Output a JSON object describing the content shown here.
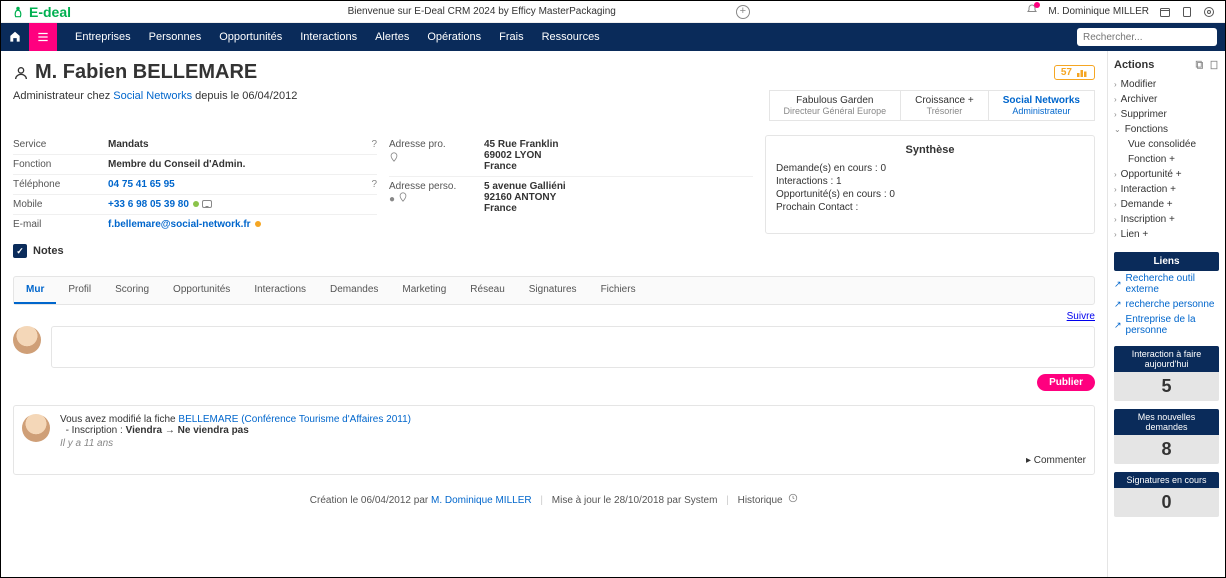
{
  "top": {
    "logo_text": "E-deal",
    "welcome": "Bienvenue sur E-Deal CRM 2024 by Efficy MasterPackaging",
    "user": "M. Dominique MILLER"
  },
  "nav": {
    "items": [
      "Entreprises",
      "Personnes",
      "Opportunités",
      "Interactions",
      "Alertes",
      "Opérations",
      "Frais",
      "Ressources"
    ],
    "search_placeholder": "Rechercher..."
  },
  "person": {
    "title": "M. Fabien BELLEMARE",
    "score": "57",
    "role_prefix": "Administrateur chez ",
    "role_company": "Social Networks",
    "role_suffix": " depuis le 06/04/2012"
  },
  "roles": [
    {
      "title": "Fabulous Garden",
      "sub": "Directeur Général Europe",
      "active": false
    },
    {
      "title": "Croissance +",
      "sub": "Trésorier",
      "active": false
    },
    {
      "title": "Social Networks",
      "sub": "Administrateur",
      "active": true
    }
  ],
  "fields_left": {
    "service_k": "Service",
    "service_v": "Mandats",
    "fonction_k": "Fonction",
    "fonction_v": "Membre du Conseil d'Admin.",
    "tel_k": "Téléphone",
    "tel_v": "04 75 41 65 95",
    "mobile_k": "Mobile",
    "mobile_v": "+33 6 98 05 39 80",
    "email_k": "E-mail",
    "email_v": "f.bellemare@social-network.fr"
  },
  "fields_mid": {
    "adrpro_k": "Adresse pro.",
    "adrpro_l1": "45 Rue Franklin",
    "adrpro_l2": "69002 LYON",
    "adrpro_l3": "France",
    "adrperso_k": "Adresse perso.",
    "adrperso_l1": "5 avenue Galliéni",
    "adrperso_l2": "92160 ANTONY",
    "adrperso_l3": "France"
  },
  "synth": {
    "title": "Synthèse",
    "l1": "Demande(s) en cours : 0",
    "l2": "Interactions : 1",
    "l3": "Opportunité(s) en cours : 0",
    "l4": "Prochain Contact :"
  },
  "notes_label": "Notes",
  "tabs": [
    "Mur",
    "Profil",
    "Scoring",
    "Opportunités",
    "Interactions",
    "Demandes",
    "Marketing",
    "Réseau",
    "Signatures",
    "Fichiers"
  ],
  "suivre": "Suivre",
  "publish": "Publier",
  "feed": {
    "prefix": "Vous avez modifié la fiche ",
    "link": "BELLEMARE (Conférence Tourisme d'Affaires 2011)",
    "change_label": "- Inscription : ",
    "change_from": "Viendra",
    "change_to": "Ne viendra pas",
    "time": "Il y a 11 ans",
    "comment": "Commenter"
  },
  "footer": {
    "created_pre": "Création le 06/04/2012 par ",
    "created_by": "M. Dominique MILLER",
    "updated": "Mise à jour le 28/10/2018 par System",
    "hist": "Historique"
  },
  "side": {
    "actions_title": "Actions",
    "actions": [
      "Modifier",
      "Archiver",
      "Supprimer",
      "Fonctions"
    ],
    "subactions": [
      "Vue consolidée",
      "Fonction +"
    ],
    "actions2": [
      "Opportunité +",
      "Interaction +",
      "Demande +",
      "Inscription +",
      "Lien +"
    ],
    "liens_title": "Liens",
    "liens": [
      "Recherche outil externe",
      "recherche personne",
      "Entreprise de la personne"
    ],
    "stat1_title": "Interaction à faire aujourd'hui",
    "stat1_val": "5",
    "stat2_title": "Mes nouvelles demandes",
    "stat2_val": "8",
    "stat3_title": "Signatures en cours",
    "stat3_val": "0"
  }
}
